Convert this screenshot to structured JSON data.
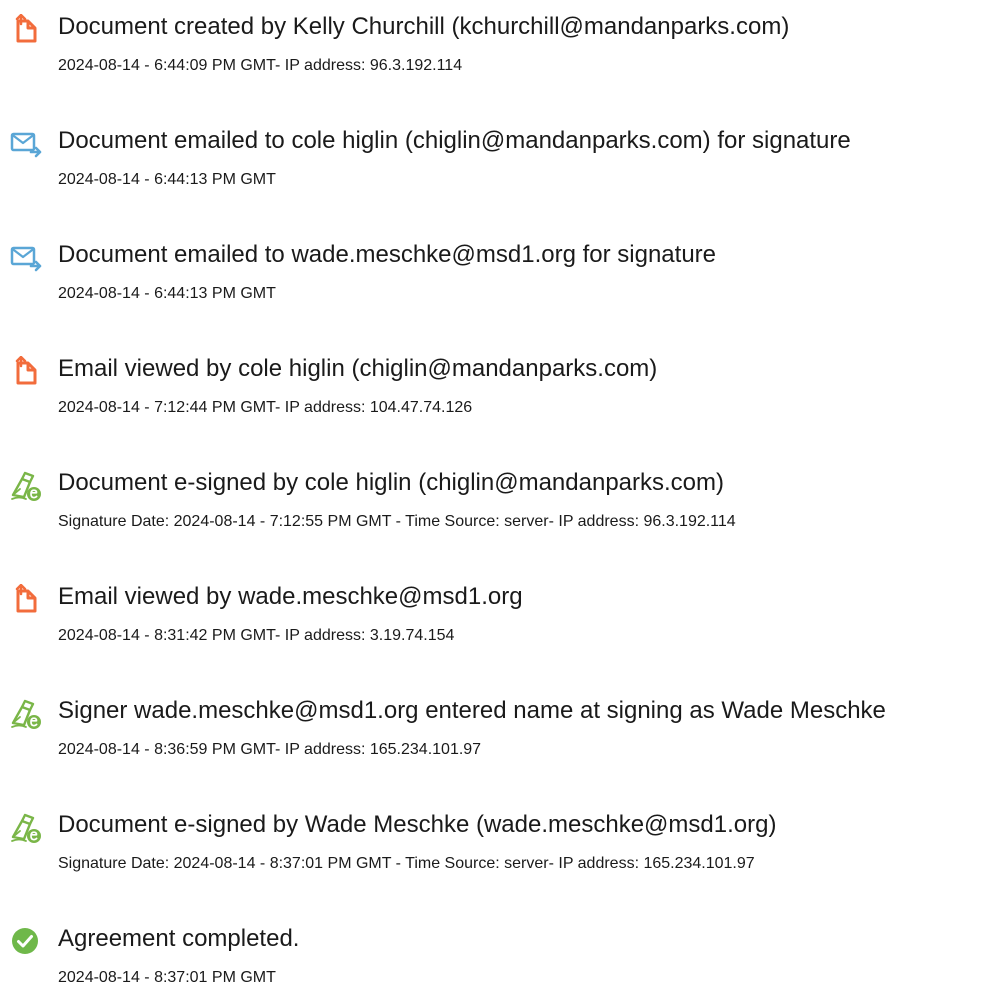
{
  "colors": {
    "document_icon": "#f26c3c",
    "email_icon": "#5aa6d6",
    "sign_icon": "#7ab648",
    "complete_icon": "#6fb84a",
    "text": "#1a1a1a"
  },
  "events": [
    {
      "icon": "document-icon",
      "title": "Document created by Kelly Churchill (kchurchill@mandanparks.com)",
      "detail": "2024-08-14 - 6:44:09 PM GMT- IP address: 96.3.192.114"
    },
    {
      "icon": "email-send-icon",
      "title": "Document emailed to cole higlin (chiglin@mandanparks.com) for signature",
      "detail": "2024-08-14 - 6:44:13 PM GMT"
    },
    {
      "icon": "email-send-icon",
      "title": "Document emailed to wade.meschke@msd1.org for signature",
      "detail": "2024-08-14 - 6:44:13 PM GMT"
    },
    {
      "icon": "document-icon",
      "title": "Email viewed by cole higlin (chiglin@mandanparks.com)",
      "detail": "2024-08-14 - 7:12:44 PM GMT- IP address: 104.47.74.126"
    },
    {
      "icon": "esign-pen-icon",
      "title": "Document e-signed by cole higlin (chiglin@mandanparks.com)",
      "detail": "Signature Date: 2024-08-14 - 7:12:55 PM GMT - Time Source: server- IP address: 96.3.192.114"
    },
    {
      "icon": "document-icon",
      "title": "Email viewed by wade.meschke@msd1.org",
      "detail": "2024-08-14 - 8:31:42 PM GMT- IP address: 3.19.74.154"
    },
    {
      "icon": "esign-pen-icon",
      "title": "Signer wade.meschke@msd1.org entered name at signing as Wade Meschke",
      "detail": "2024-08-14 - 8:36:59 PM GMT- IP address: 165.234.101.97"
    },
    {
      "icon": "esign-pen-icon",
      "title": "Document e-signed by Wade Meschke (wade.meschke@msd1.org)",
      "detail": "Signature Date: 2024-08-14 - 8:37:01 PM GMT - Time Source: server- IP address: 165.234.101.97"
    },
    {
      "icon": "check-circle-icon",
      "title": "Agreement completed.",
      "detail": "2024-08-14 - 8:37:01 PM GMT"
    }
  ]
}
